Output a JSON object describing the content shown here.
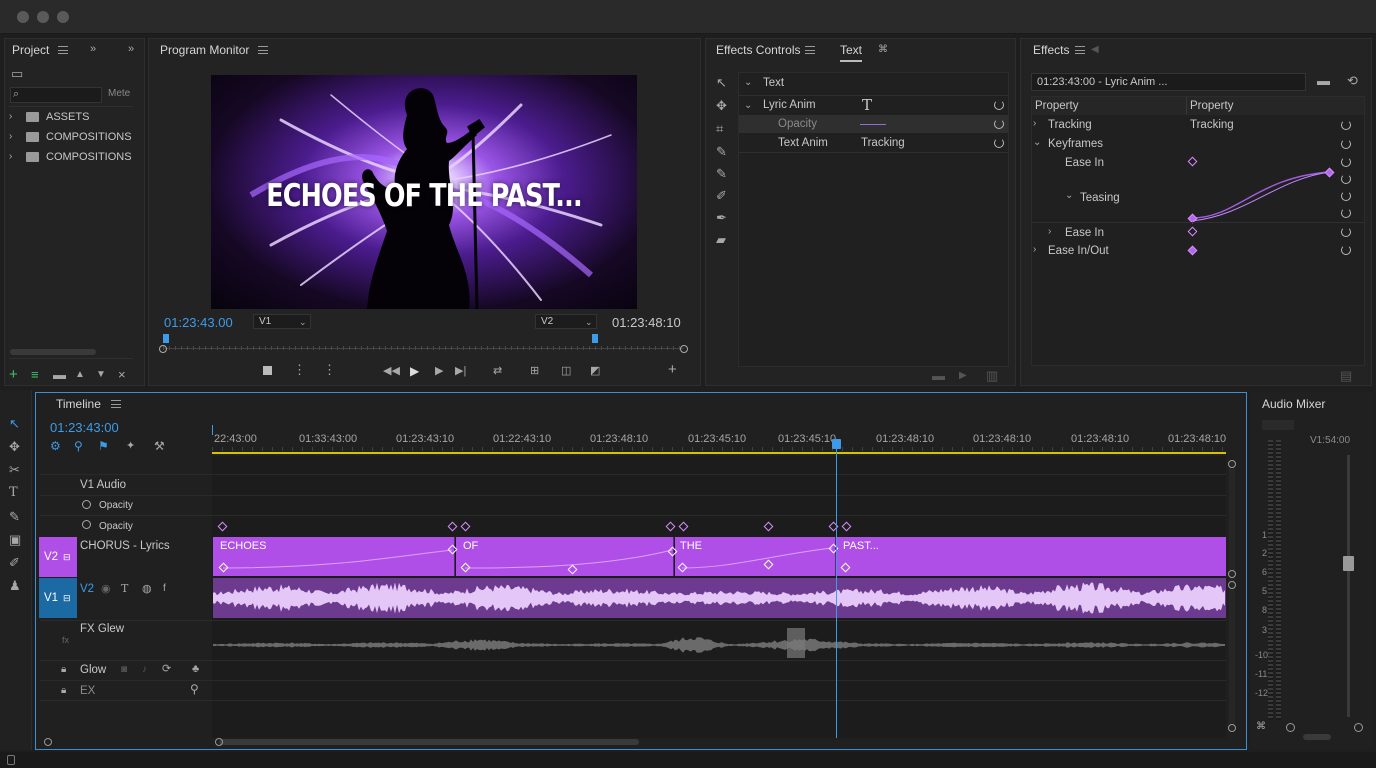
{
  "window": {
    "buttons": [
      "close",
      "minimize",
      "maximize"
    ]
  },
  "project": {
    "title": "Project",
    "search_label": "Mete",
    "folders": [
      "ASSETS",
      "COMPOSITIONS",
      "COMPOSITIONS"
    ]
  },
  "program_monitor": {
    "title": "Program Monitor",
    "video_title": "ECHOES OF THE PAST...",
    "timecode_in": "01:23:43.00",
    "timecode_out": "01:23:48:10",
    "track_a": "V1",
    "track_b": "V2",
    "progress": 0.0
  },
  "effects_controls": {
    "title": "Effects Controls",
    "tab_text": "Text",
    "rows": [
      {
        "label": "Text",
        "value": ""
      },
      {
        "label": "Lyric Anim",
        "value": "T"
      },
      {
        "label": "Opacity",
        "value": ""
      },
      {
        "label": "Text Anim",
        "value": "Tracking"
      }
    ]
  },
  "effects": {
    "title": "Effects",
    "search_value": "01:23:43:00 - Lyric Anim ...",
    "col_a": "Property",
    "col_b": "Property",
    "rows": [
      {
        "label": "Tracking",
        "value": "Tracking"
      },
      {
        "label": "Keyframes",
        "value": ""
      },
      {
        "label": "Ease In",
        "value": ""
      },
      {
        "label": "Teasing",
        "value": ""
      },
      {
        "label": "Ease In",
        "value": ""
      },
      {
        "label": "Ease In/Out",
        "value": ""
      }
    ]
  },
  "timeline": {
    "title": "Timeline",
    "timecode": "01:23:43:00",
    "ruler": [
      "22:43:00",
      "01:33:43:00",
      "01:23:43:10",
      "01:22:43:10",
      "01:23:48:10",
      "01:23:45:10",
      "01:23:45:10",
      "01:23:48:10",
      "01:23:48:10",
      "01:23:48:10",
      "01:23:48:10"
    ],
    "tracks": {
      "v1_audio": "V1  Audio",
      "opacity1": "Opacity",
      "opacity2": "Opacity",
      "v2_label": "V2",
      "chorus": "CHORUS - Lyrics",
      "v1_label": "V1",
      "v2_sub": "V2",
      "fx_glow": "FX Glew",
      "glow": "Glow",
      "ex": "EX"
    },
    "clips": [
      "ECHOES",
      "OF",
      "THE",
      "PAST..."
    ]
  },
  "audio_mixer": {
    "title": "Audio Mixer",
    "readout": "V1:54:00",
    "scale": [
      "1",
      "2",
      "6",
      "5",
      "8",
      "3",
      "-10",
      "-11",
      "-12"
    ]
  },
  "colors": {
    "accent": "#3d9be9",
    "clip": "#b04fe8",
    "clip_light": "#c46cf3"
  }
}
